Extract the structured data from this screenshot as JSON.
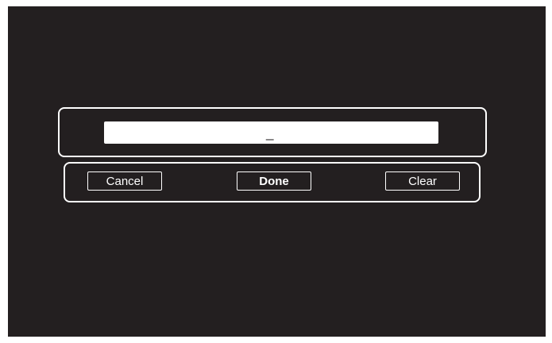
{
  "keyboard_dialog": {
    "input": {
      "value": "_"
    },
    "buttons": {
      "cancel_label": "Cancel",
      "done_label": "Done",
      "clear_label": "Clear"
    }
  },
  "colors": {
    "background": "#231f20",
    "foreground": "#ffffff"
  }
}
